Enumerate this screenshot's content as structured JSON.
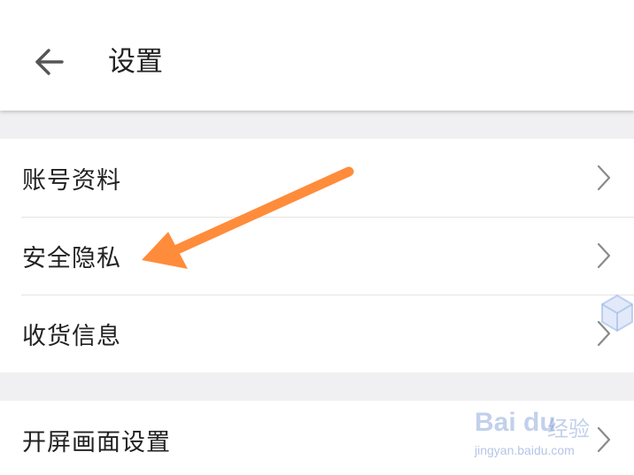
{
  "header": {
    "title": "设置",
    "back_icon": "arrow-left-icon"
  },
  "settings": {
    "group1": [
      {
        "label": "账号资料",
        "icon": "chevron-right-icon"
      },
      {
        "label": "安全隐私",
        "icon": "chevron-right-icon"
      },
      {
        "label": "收货信息",
        "icon": "chevron-right-icon"
      }
    ],
    "group2": [
      {
        "label": "开屏画面设置",
        "icon": "chevron-right-icon"
      }
    ]
  },
  "annotation": {
    "color": "#ff8c3a"
  },
  "watermark": {
    "logo": "Bai du",
    "brand": "经验",
    "url": "jingyan.baidu.com"
  },
  "colors": {
    "background": "#f0f0f2",
    "card": "#ffffff",
    "text": "#222222",
    "divider": "#e4e4e4",
    "chevron": "#8a8a8a"
  }
}
